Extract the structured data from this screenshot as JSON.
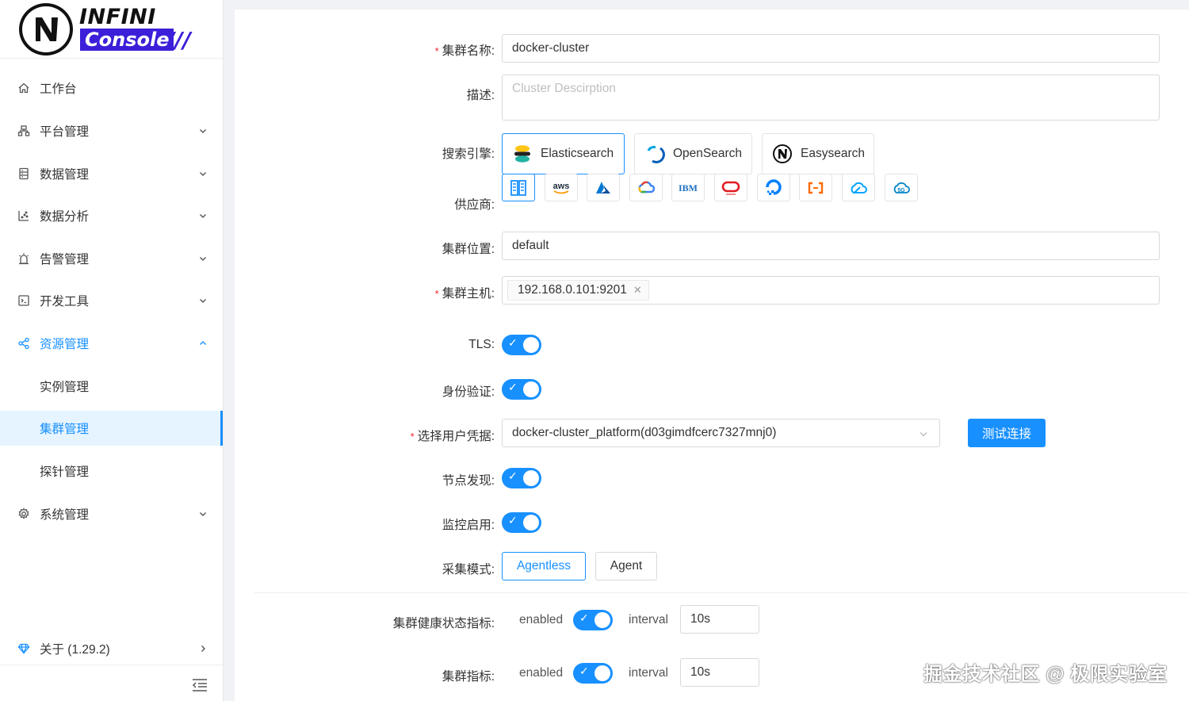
{
  "logo": {
    "word1": "INFINI",
    "word2": "Console",
    "slashes": "///"
  },
  "sidebar": {
    "items": [
      {
        "label": "工作台",
        "icon": "home-icon"
      },
      {
        "label": "平台管理",
        "icon": "cluster-icon"
      },
      {
        "label": "数据管理",
        "icon": "database-icon"
      },
      {
        "label": "数据分析",
        "icon": "chart-icon"
      },
      {
        "label": "告警管理",
        "icon": "alarm-icon"
      },
      {
        "label": "开发工具",
        "icon": "code-icon"
      },
      {
        "label": "资源管理",
        "icon": "share-icon"
      },
      {
        "label": "实例管理"
      },
      {
        "label": "集群管理"
      },
      {
        "label": "探针管理"
      },
      {
        "label": "系统管理",
        "icon": "gear-icon"
      }
    ],
    "about": "关于 (1.29.2)"
  },
  "form": {
    "cluster_name_label": "集群名称:",
    "cluster_name_value": "docker-cluster",
    "description_label": "描述:",
    "description_placeholder": "Cluster Descirption",
    "engine_label": "搜索引擎:",
    "engines": [
      "Elasticsearch",
      "OpenSearch",
      "Easysearch"
    ],
    "provider_label": "供应商:",
    "providers": [
      "on-premise",
      "aws",
      "azure",
      "google-cloud",
      "ibm",
      "oracle",
      "digitalocean",
      "aliyun",
      "tencent-cloud",
      "huawei-cloud"
    ],
    "location_label": "集群位置:",
    "location_value": "default",
    "host_label": "集群主机:",
    "host_tag": "192.168.0.101:9201",
    "tls_label": "TLS:",
    "auth_label": "身份验证:",
    "credential_label": "选择用户凭据:",
    "credential_value": "docker-cluster_platform(d03gimdfcerc7327mnj0)",
    "test_button": "测试连接",
    "discovery_label": "节点发现:",
    "monitor_label": "监控启用:",
    "mode_label": "采集模式:",
    "mode_options": [
      "Agentless",
      "Agent"
    ],
    "health_label": "集群健康状态指标:",
    "metrics_label": "集群指标:",
    "enabled_text": "enabled",
    "interval_text": "interval",
    "health_interval": "10s",
    "metrics_interval": "10s"
  },
  "watermark": "掘金技术社区 @ 极限实验室",
  "colors": {
    "primary": "#1890ff",
    "brand": "#3b1fd9"
  }
}
